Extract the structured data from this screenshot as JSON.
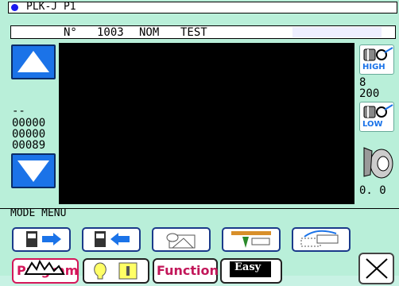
{
  "titlebar": {
    "title": "PLK-J P1"
  },
  "infobar": {
    "no_label": "N°",
    "number": "1003",
    "nom_label": "NOM",
    "name": "TEST"
  },
  "left_counters": {
    "c0": "--",
    "c1": "00000",
    "c2": "00000",
    "c3": "00089"
  },
  "right_panel": {
    "high_label": "HIGH",
    "v1": "8",
    "v2": "200",
    "low_label": "LOW",
    "v3": "0. 0"
  },
  "mode": {
    "label": "MODE MENU"
  },
  "buttons": {
    "program": "Program",
    "function": "Function",
    "easy": "Easy"
  },
  "colors": {
    "background": "#b9efd9",
    "accent_blue": "#1b73e8",
    "program_text": "#d4175a"
  }
}
